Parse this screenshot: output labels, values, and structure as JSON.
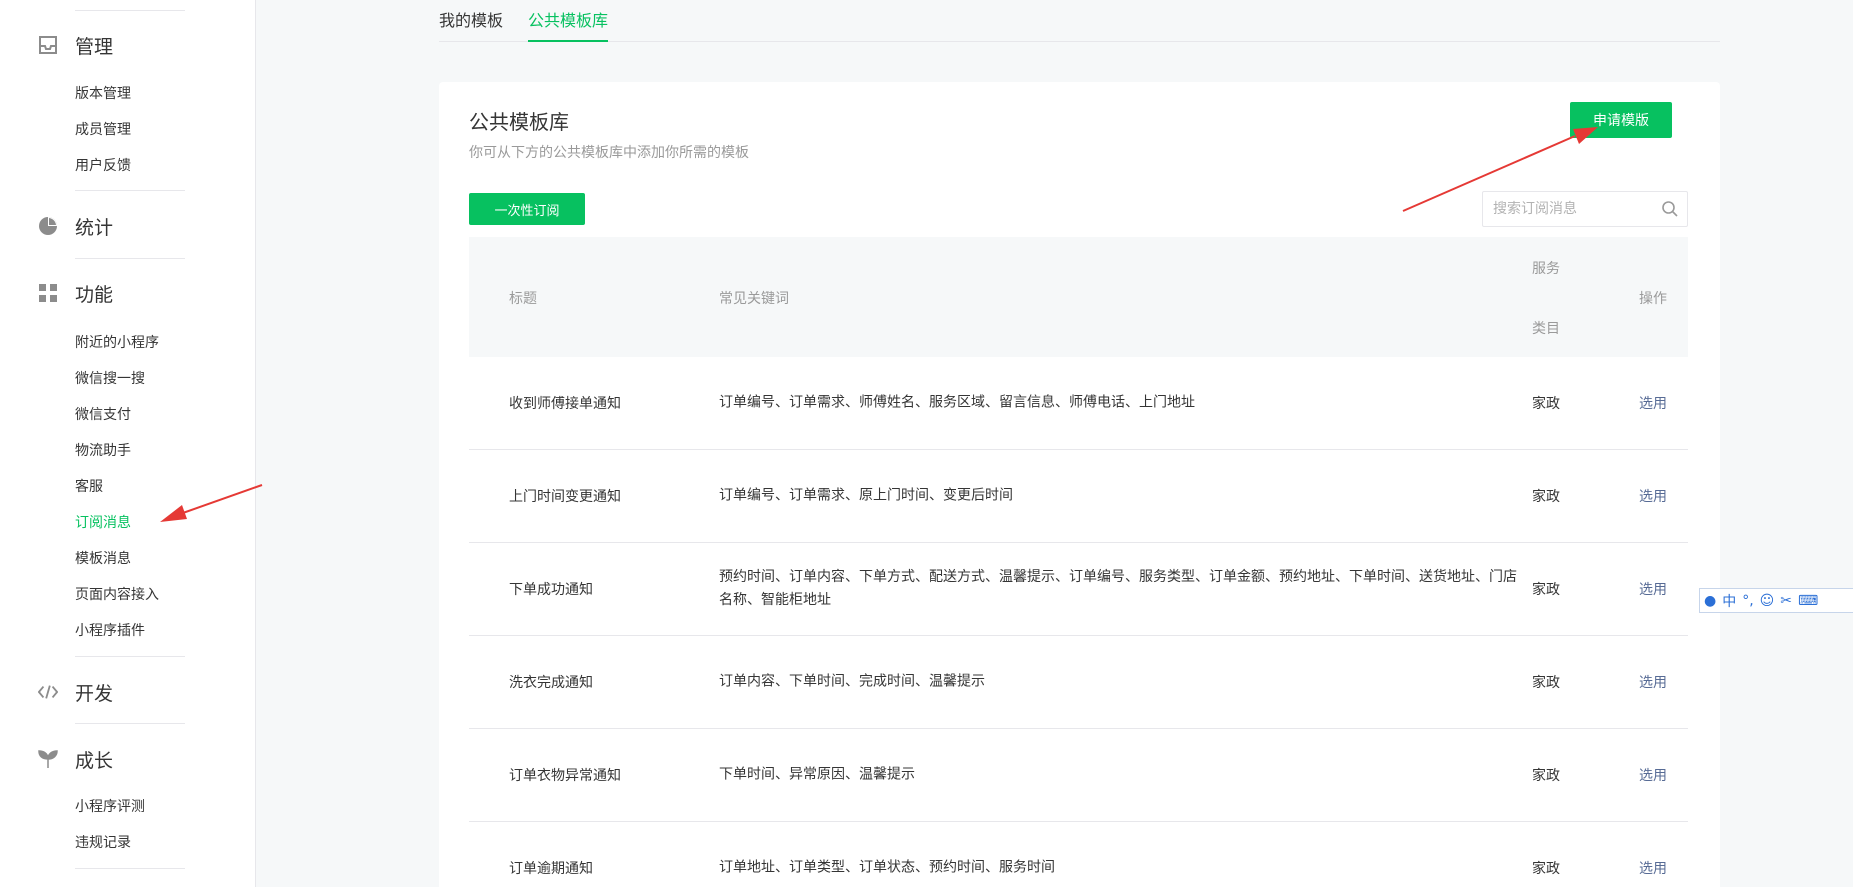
{
  "sidebar": {
    "sections": [
      {
        "name": "manage",
        "label": "管理",
        "icon": "inbox-icon",
        "items": [
          "版本管理",
          "成员管理",
          "用户反馈"
        ]
      },
      {
        "name": "stats",
        "label": "统计",
        "icon": "pie-chart-icon",
        "items": []
      },
      {
        "name": "features",
        "label": "功能",
        "icon": "grid-icon",
        "items": [
          "附近的小程序",
          "微信搜一搜",
          "微信支付",
          "物流助手",
          "客服",
          "订阅消息",
          "模板消息",
          "页面内容接入",
          "小程序插件"
        ]
      },
      {
        "name": "develop",
        "label": "开发",
        "icon": "code-icon",
        "items": []
      },
      {
        "name": "growth",
        "label": "成长",
        "icon": "sprout-icon",
        "items": [
          "小程序评测",
          "违规记录"
        ]
      }
    ],
    "active_item": "订阅消息"
  },
  "tabs": [
    {
      "label": "我的模板",
      "active": false
    },
    {
      "label": "公共模板库",
      "active": true
    }
  ],
  "panel": {
    "title": "公共模板库",
    "description": "你可从下方的公共模板库中添加你所需的模板",
    "apply_button": "申请模版",
    "once_button": "一次性订阅",
    "search_placeholder": "搜索订阅消息"
  },
  "table": {
    "headers": {
      "title": "标题",
      "keywords": "常见关键词",
      "category_line1": "服务",
      "category_line2": "类目",
      "action": "操作"
    },
    "rows": [
      {
        "title": "收到师傅接单通知",
        "keywords": "订单编号、订单需求、师傅姓名、服务区域、留言信息、师傅电话、上门地址",
        "category": "家政",
        "action": "选用"
      },
      {
        "title": "上门时间变更通知",
        "keywords": "订单编号、订单需求、原上门时间、变更后时间",
        "category": "家政",
        "action": "选用"
      },
      {
        "title": "下单成功通知",
        "keywords": "预约时间、订单内容、下单方式、配送方式、温馨提示、订单编号、服务类型、订单金额、预约地址、下单时间、送货地址、门店名称、智能柜地址",
        "category": "家政",
        "action": "选用"
      },
      {
        "title": "洗衣完成通知",
        "keywords": "订单内容、下单时间、完成时间、温馨提示",
        "category": "家政",
        "action": "选用"
      },
      {
        "title": "订单衣物异常通知",
        "keywords": "下单时间、异常原因、温馨提示",
        "category": "家政",
        "action": "选用"
      },
      {
        "title": "订单逾期通知",
        "keywords": "订单地址、订单类型、订单状态、预约时间、服务时间",
        "category": "家政",
        "action": "选用"
      }
    ]
  },
  "ime": {
    "mode": "中"
  },
  "colors": {
    "accent": "#07c160",
    "link": "#576b95",
    "arrow": "#e53935"
  }
}
